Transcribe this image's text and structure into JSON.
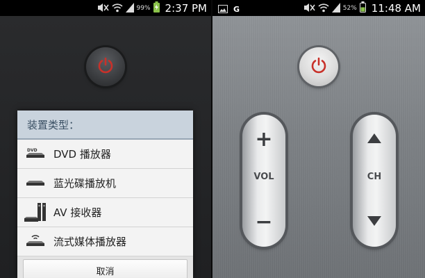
{
  "left_screen": {
    "status_bar": {
      "battery_percent": "99%",
      "time": "2:37 PM"
    },
    "dialog": {
      "title": "装置类型：",
      "items": [
        {
          "label": "DVD 播放器",
          "icon": "dvd-player-icon"
        },
        {
          "label": "蓝光碟播放机",
          "icon": "bluray-player-icon"
        },
        {
          "label": "AV 接收器",
          "icon": "av-receiver-icon"
        },
        {
          "label": "流式媒体播放器",
          "icon": "streaming-player-icon"
        }
      ],
      "cancel_label": "取消"
    }
  },
  "right_screen": {
    "status_bar": {
      "carrier_badge": "G",
      "battery_percent": "52%",
      "time": "11:48 AM"
    },
    "volume": {
      "label": "VOL",
      "plus": "+",
      "minus": "−"
    },
    "channel": {
      "label": "CH"
    }
  },
  "colors": {
    "power_red": "#c8312a",
    "dialog_title_bg": "#c9d3dd",
    "metal": "#7c8084"
  }
}
